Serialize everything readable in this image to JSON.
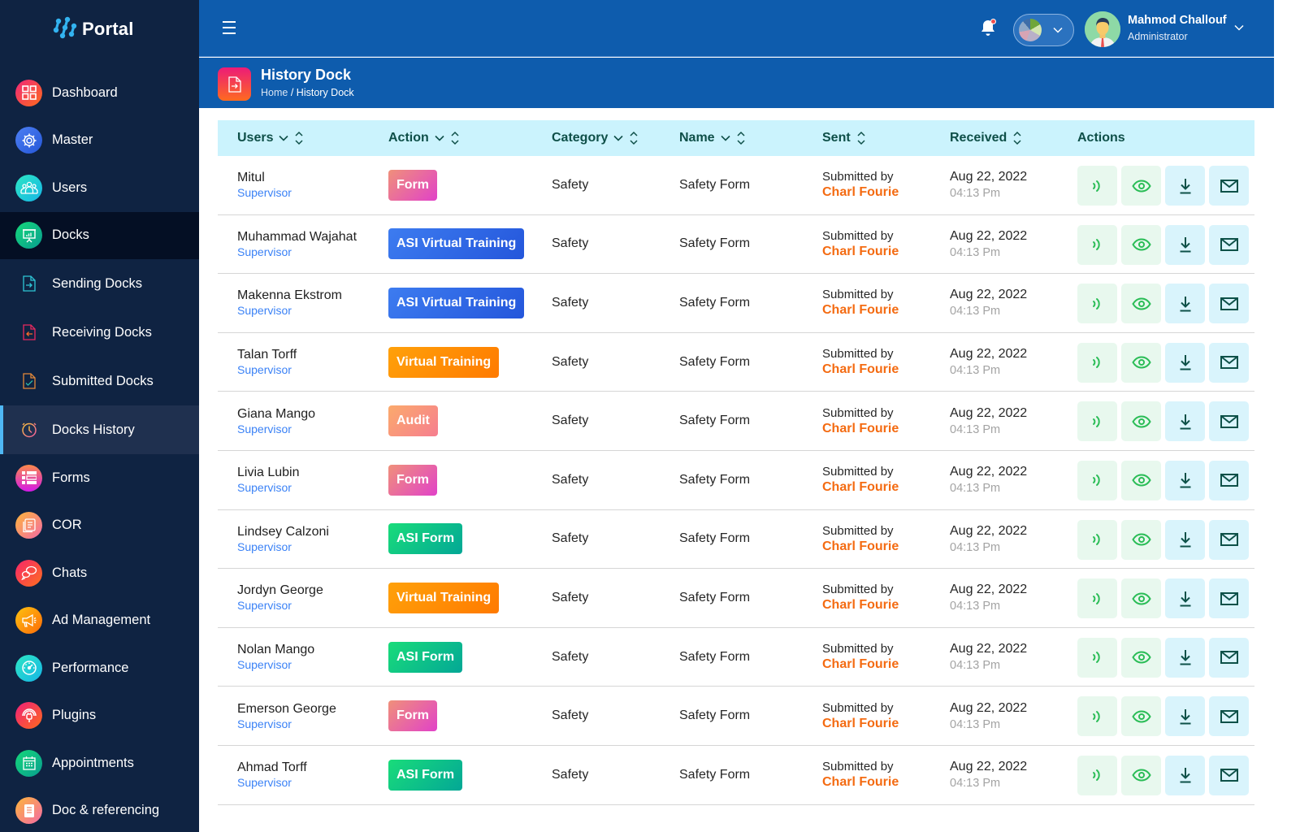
{
  "app": {
    "logo_text": "Portal"
  },
  "sidebar": {
    "items": [
      {
        "label": "Dashboard",
        "icon": "dashboard-grid-icon",
        "color": "#f0277a"
      },
      {
        "label": "Master",
        "icon": "gear-icon",
        "color": "#3a6ff0"
      },
      {
        "label": "Users",
        "icon": "users-group-icon",
        "color": "#19c9d6"
      },
      {
        "label": "Docks",
        "icon": "presentation-board-icon",
        "color": "#10c97a"
      },
      {
        "label": "Sending Docks",
        "icon": "file-arrow-right-icon"
      },
      {
        "label": "Receiving Docks",
        "icon": "file-arrow-left-icon"
      },
      {
        "label": "Submitted Docks",
        "icon": "file-check-icon"
      },
      {
        "label": "Docks History",
        "icon": "clock-icon"
      },
      {
        "label": "Forms",
        "icon": "list-form-icon"
      },
      {
        "label": "COR",
        "icon": "document-stack-icon"
      },
      {
        "label": "Chats",
        "icon": "chat-bubbles-icon"
      },
      {
        "label": "Ad Management",
        "icon": "megaphone-icon"
      },
      {
        "label": "Performance",
        "icon": "speedometer-icon"
      },
      {
        "label": "Plugins",
        "icon": "plug-icon"
      },
      {
        "label": "Appointments",
        "icon": "calendar-icon"
      },
      {
        "label": "Doc & referencing",
        "icon": "clipboard-icon"
      }
    ]
  },
  "header": {
    "user_name": "Mahmod Challouf",
    "user_role": "Administrator"
  },
  "page": {
    "title": "History Dock",
    "breadcrumb_home": "Home",
    "breadcrumb_sep": "/",
    "breadcrumb_current": "History Dock"
  },
  "table": {
    "columns": [
      "Users",
      "Action",
      "Category",
      "Name",
      "Sent",
      "Received",
      "Actions"
    ],
    "rows": [
      {
        "user": "Mitul",
        "role": "Supervisor",
        "action": "Form",
        "category": "Safety",
        "name": "Safety Form",
        "sent_label": "Submitted by",
        "sent_by": "Charl Fourie",
        "date": "Aug 22, 2022",
        "time": "04:13 Pm"
      },
      {
        "user": "Muhammad Wajahat",
        "role": "Supervisor",
        "action": "ASI Virtual Training",
        "category": "Safety",
        "name": "Safety Form",
        "sent_label": "Submitted by",
        "sent_by": "Charl Fourie",
        "date": "Aug 22, 2022",
        "time": "04:13 Pm"
      },
      {
        "user": "Makenna Ekstrom",
        "role": "Supervisor",
        "action": "ASI Virtual Training",
        "category": "Safety",
        "name": "Safety Form",
        "sent_label": "Submitted by",
        "sent_by": "Charl Fourie",
        "date": "Aug 22, 2022",
        "time": "04:13 Pm"
      },
      {
        "user": "Talan Torff",
        "role": "Supervisor",
        "action": "Virtual Training",
        "category": "Safety",
        "name": "Safety Form",
        "sent_label": "Submitted by",
        "sent_by": "Charl Fourie",
        "date": "Aug 22, 2022",
        "time": "04:13 Pm"
      },
      {
        "user": "Giana Mango",
        "role": "Supervisor",
        "action": "Audit",
        "category": "Safety",
        "name": "Safety Form",
        "sent_label": "Submitted by",
        "sent_by": "Charl Fourie",
        "date": "Aug 22, 2022",
        "time": "04:13 Pm"
      },
      {
        "user": "Livia Lubin",
        "role": "Supervisor",
        "action": "Form",
        "category": "Safety",
        "name": "Safety Form",
        "sent_label": "Submitted by",
        "sent_by": "Charl Fourie",
        "date": "Aug 22, 2022",
        "time": "04:13 Pm"
      },
      {
        "user": "Lindsey Calzoni",
        "role": "Supervisor",
        "action": "ASI Form",
        "category": "Safety",
        "name": "Safety Form",
        "sent_label": "Submitted by",
        "sent_by": "Charl Fourie",
        "date": "Aug 22, 2022",
        "time": "04:13 Pm"
      },
      {
        "user": "Jordyn George",
        "role": "Supervisor",
        "action": "Virtual Training",
        "category": "Safety",
        "name": "Safety Form",
        "sent_label": "Submitted by",
        "sent_by": "Charl Fourie",
        "date": "Aug 22, 2022",
        "time": "04:13 Pm"
      },
      {
        "user": "Nolan Mango",
        "role": "Supervisor",
        "action": "ASI Form",
        "category": "Safety",
        "name": "Safety Form",
        "sent_label": "Submitted by",
        "sent_by": "Charl Fourie",
        "date": "Aug 22, 2022",
        "time": "04:13 Pm"
      },
      {
        "user": "Emerson George",
        "role": "Supervisor",
        "action": "Form",
        "category": "Safety",
        "name": "Safety Form",
        "sent_label": "Submitted by",
        "sent_by": "Charl Fourie",
        "date": "Aug 22, 2022",
        "time": "04:13 Pm"
      },
      {
        "user": "Ahmad Torff",
        "role": "Supervisor",
        "action": "ASI Form",
        "category": "Safety",
        "name": "Safety Form",
        "sent_label": "Submitted by",
        "sent_by": "Charl Fourie",
        "date": "Aug 22, 2022",
        "time": "04:13 Pm"
      }
    ],
    "row_actions": [
      "send",
      "view",
      "download",
      "email"
    ]
  },
  "badge_styles": {
    "Form": [
      "#f0907a",
      "#e142c8"
    ],
    "ASI Virtual Training": [
      "#3d7cf0",
      "#2456db"
    ],
    "Virtual Training": [
      "#ffa10a",
      "#ff7a00"
    ],
    "Audit": [
      "#fbaa6c",
      "#f67e8f"
    ],
    "ASI Form": [
      "#19dc7a",
      "#03a796"
    ]
  },
  "colors": {
    "sidebar_bg": "#0f2342",
    "header_bg": "#0e5cad",
    "table_head_bg": "#cbf3fd",
    "accent_orange": "#f46b12",
    "role_blue": "#3b82f6"
  }
}
